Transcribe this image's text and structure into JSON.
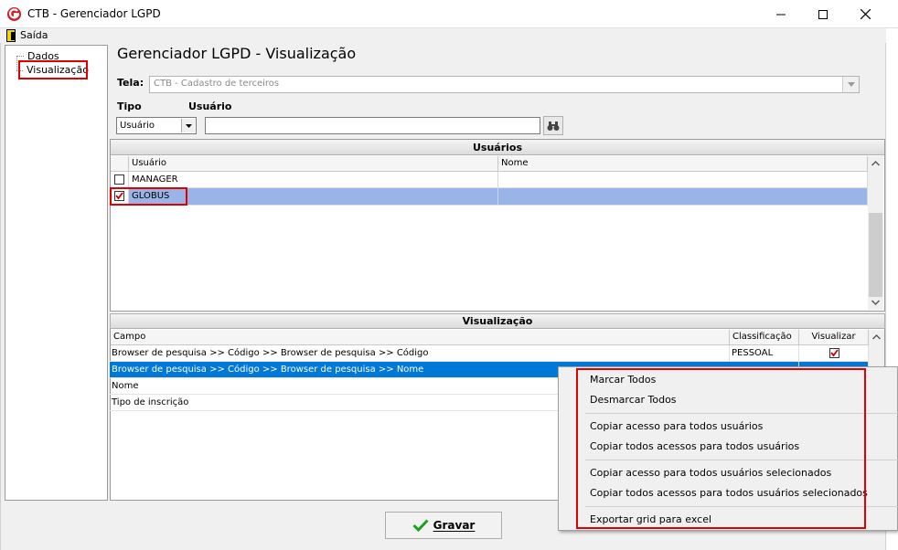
{
  "window": {
    "title": "CTB - Gerenciador LGPD"
  },
  "menu": {
    "exit": "Saída"
  },
  "tree": {
    "items": [
      {
        "label": "Dados"
      },
      {
        "label": "Visualização"
      }
    ]
  },
  "page": {
    "title": "Gerenciador LGPD - Visualização"
  },
  "form": {
    "tela_label": "Tela:",
    "tela_value": "CTB - Cadastro de terceiros",
    "tipo_label": "Tipo",
    "tipo_value": "Usuário",
    "usuario_label": "Usuário",
    "usuario_value": ""
  },
  "usuarios": {
    "header": "Usuários",
    "columns": [
      "Usuário",
      "Nome"
    ],
    "rows": [
      {
        "checked": false,
        "usuario": "MANAGER",
        "nome": ""
      },
      {
        "checked": true,
        "usuario": "GLOBUS",
        "nome": ""
      }
    ]
  },
  "visualizacao": {
    "header": "Visualização",
    "columns": [
      "Campo",
      "Classificação",
      "Visualizar"
    ],
    "rows": [
      {
        "campo": "Browser de pesquisa >> Código >> Browser de pesquisa >> Código",
        "classificacao": "PESSOAL",
        "visualizar": true
      },
      {
        "campo": "Browser de pesquisa >> Código >> Browser de pesquisa >> Nome",
        "classificacao": "",
        "visualizar": true
      },
      {
        "campo": "Nome",
        "classificacao": "",
        "visualizar": false
      },
      {
        "campo": "Tipo de inscrição",
        "classificacao": "",
        "visualizar": false
      }
    ]
  },
  "buttons": {
    "gravar": "Gravar"
  },
  "context_menu": {
    "items": [
      "Marcar Todos",
      "Desmarcar Todos",
      "Copiar acesso para todos usuários",
      "Copiar todos acessos para todos usuários",
      "Copiar acesso para todos usuários selecionados",
      "Copiar todos acessos para todos usuários selecionados",
      "Exportar grid para excel"
    ]
  },
  "colors": {
    "selected_row": "#99b4e6",
    "highlight_row": "#0078d7",
    "annotation": "#e00000",
    "check": "#cc0000"
  }
}
